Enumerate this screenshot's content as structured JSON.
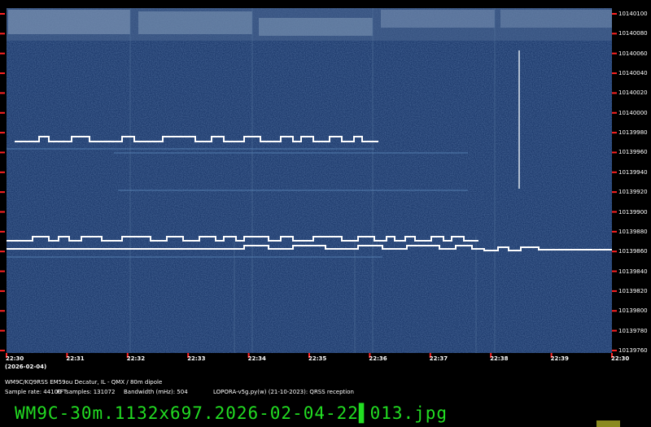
{
  "y_axis": {
    "ticks": [
      "10140100",
      "10140080",
      "10140060",
      "10140040",
      "10140020",
      "10140000",
      "10139980",
      "10139960",
      "10139940",
      "10139920",
      "10139900",
      "10139880",
      "10139860",
      "10139840",
      "10139820",
      "10139800",
      "10139780",
      "10139760"
    ]
  },
  "x_axis": {
    "ticks": [
      "22:30",
      "22:31",
      "22:32",
      "22:33",
      "22:34",
      "22:35",
      "22:36",
      "22:37",
      "22:38",
      "22:39",
      "22:30"
    ],
    "date": "(2026-02-04)"
  },
  "info": {
    "station": "WM9C/KQ9RSS EM59ou Decatur, IL - QMX / 80m dipole",
    "sample_rate": "Sample rate: 44100",
    "fft": "FFTsamples: 131072",
    "bandwidth": "Bandwidth (mHz): 504",
    "software": "LOPORA-v5g.py(w) (21-10-2023): QRSS reception"
  },
  "filename": "WM9C-30m.1132x697.2026-02-04-22▌013.jpg",
  "colors": {
    "background": "#1f3c6e",
    "signal": "#ffffff",
    "filename": "#22dd22",
    "tick_marks": "#ff2222"
  }
}
